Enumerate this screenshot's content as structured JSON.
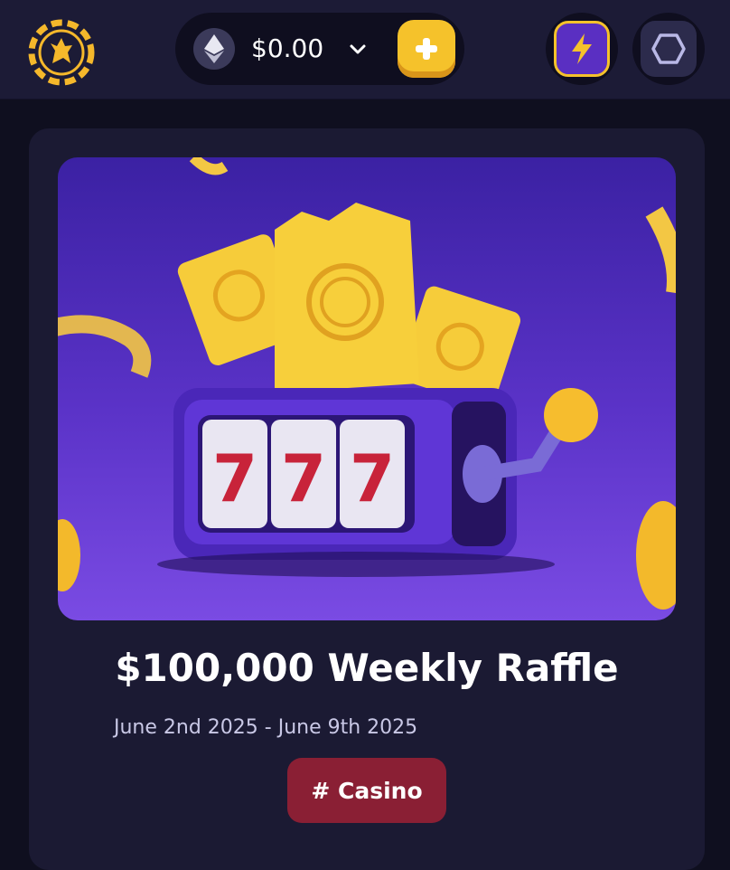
{
  "header": {
    "logo_icon": "kangaroo-chip-logo",
    "wallet": {
      "currency_icon": "ethereum-icon",
      "balance": "$0.00",
      "dropdown_icon": "chevron-down-icon",
      "add_icon": "plus-icon"
    },
    "boost_icon": "lightning-icon",
    "menu_icon": "hexagon-icon"
  },
  "raffle": {
    "banner_image": "slot-machine-777-tickets",
    "title": "$100,000 Weekly Raffle",
    "dates": "June 2nd 2025 - June 9th 2025",
    "tag": "# Casino"
  },
  "colors": {
    "gold": "#f5c22b",
    "purple": "#5a2fc2",
    "tag_red": "#8a1f34",
    "card_bg": "#1b1a33"
  }
}
